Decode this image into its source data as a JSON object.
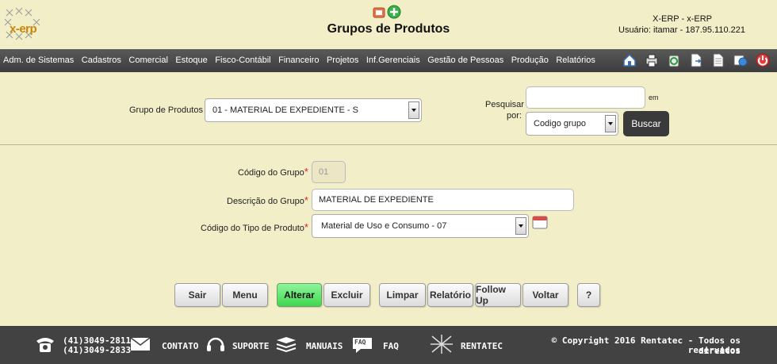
{
  "header": {
    "logo_text": "x-erp",
    "title": "Grupos de Produtos",
    "system_name": "X-ERP - x-ERP",
    "user_info": "Usuário: itamar - 187.95.110.221"
  },
  "menu": {
    "items": [
      "Adm. de Sistemas",
      "Cadastros",
      "Comercial",
      "Estoque",
      "Fisco-Contábil",
      "Financeiro",
      "Projetos",
      "Inf.Gerenciais",
      "Gestão de Pessoas",
      "Produção",
      "Relatórios"
    ]
  },
  "search": {
    "group_label": "Grupo de Produtos",
    "group_value": "01 - MATERIAL DE EXPEDIENTE - S",
    "search_label_1": "Pesquisar",
    "search_label_2": "por:",
    "search_em": "em",
    "search_input_value": "",
    "search_by_value": "Codigo grupo",
    "buscar_label": "Buscar"
  },
  "form": {
    "codigo_label": "Código do Grupo",
    "codigo_value": "01",
    "descricao_label": "Descrição do Grupo",
    "descricao_value": "MATERIAL DE EXPEDIENTE",
    "tipo_label": "Código do Tipo de Produto",
    "tipo_value": "Material de Uso e Consumo - 07",
    "required_mark": "*"
  },
  "buttons": {
    "sair": "Sair",
    "menu": "Menu",
    "alterar": "Alterar",
    "excluir": "Excluir",
    "limpar": "Limpar",
    "relatorio": "Relatório",
    "followup": "Follow Up",
    "voltar": "Voltar",
    "help": "?"
  },
  "footer": {
    "phone1": "(41)3049-2811",
    "phone2": "(41)3049-2833",
    "contato": "CONTATO",
    "suporte": "SUPORTE",
    "manuais": "MANUAIS",
    "faq_badge": "FAQ",
    "faq": "FAQ",
    "rentatec": "RENTATEC",
    "copyright_1": "© Copyright 2016 Rentatec - Todos os direitos",
    "copyright_2": "reservados"
  },
  "colors": {
    "background": "#f2eec8",
    "menubar": "#424242",
    "accent_green": "#3fd84f",
    "required": "#dd2222"
  }
}
